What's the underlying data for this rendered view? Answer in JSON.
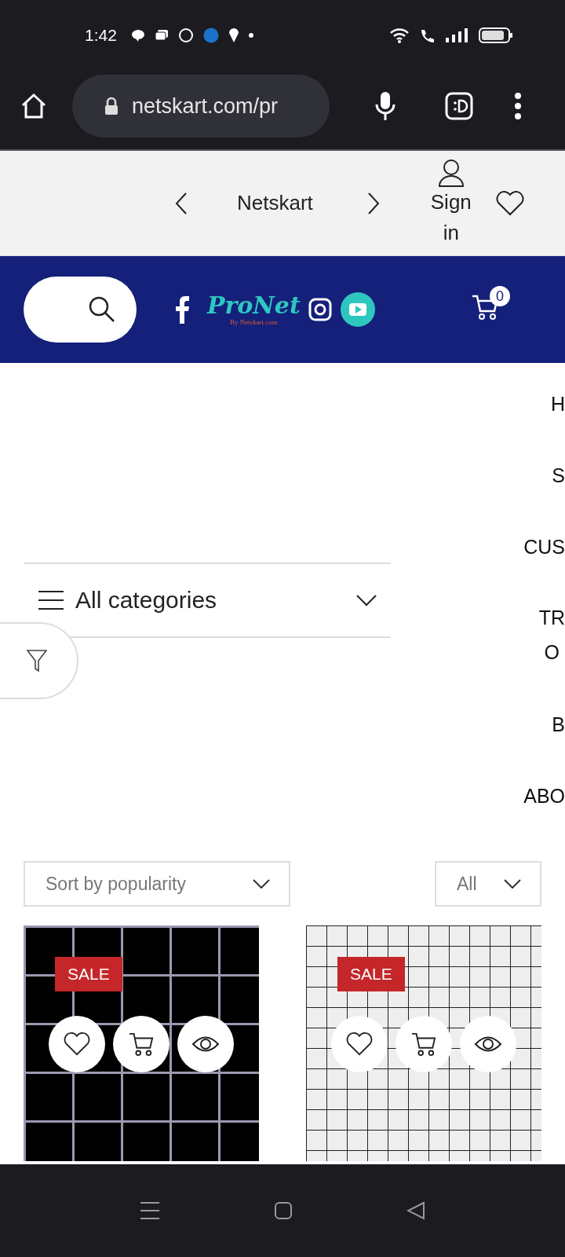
{
  "status_bar": {
    "time": "1:42"
  },
  "browser": {
    "url": "netskart.com/pr"
  },
  "top_bar": {
    "title": "Netskart",
    "sign_in": "Sign in"
  },
  "header": {
    "logo": "ProNet",
    "logo_sub": "By Netskart.com",
    "cart_count": "0"
  },
  "menu": [
    {
      "lines": [
        "H"
      ]
    },
    {
      "lines": [
        "S"
      ]
    },
    {
      "lines": [
        "CUS"
      ]
    },
    {
      "lines": [
        "TR",
        "O"
      ]
    },
    {
      "lines": [
        "B"
      ]
    },
    {
      "lines": [
        "ABO"
      ]
    }
  ],
  "categories": {
    "label": "All categories"
  },
  "sort": {
    "value": "Sort by popularity"
  },
  "per_page": {
    "value": "All"
  },
  "products": [
    {
      "badge": "SALE",
      "kind": "dark"
    },
    {
      "badge": "SALE",
      "kind": "light"
    }
  ]
}
